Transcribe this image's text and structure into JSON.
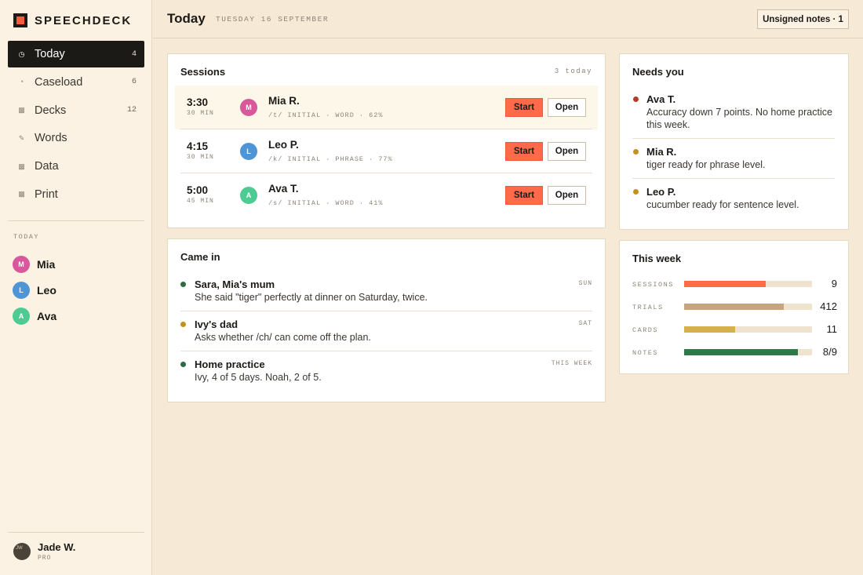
{
  "brand": {
    "name": "SPEECHDECK"
  },
  "nav": [
    {
      "label": "Today",
      "count": "4",
      "icon": "clock-icon",
      "active": true
    },
    {
      "label": "Caseload",
      "count": "6",
      "icon": "pie-icon",
      "active": false
    },
    {
      "label": "Decks",
      "count": "12",
      "icon": "square-icon",
      "active": false
    },
    {
      "label": "Words",
      "count": "",
      "icon": "pencil-icon",
      "active": false
    },
    {
      "label": "Data",
      "count": "",
      "icon": "square-icon",
      "active": false
    },
    {
      "label": "Print",
      "count": "",
      "icon": "square-icon",
      "active": false
    }
  ],
  "today_section": {
    "heading": "TODAY",
    "clients": [
      {
        "initial": "M",
        "name": "Mia",
        "color": "#d9579b"
      },
      {
        "initial": "L",
        "name": "Leo",
        "color": "#4f95d6"
      },
      {
        "initial": "A",
        "name": "Ava",
        "color": "#4ecb93"
      }
    ]
  },
  "user": {
    "name": "Jade W.",
    "role": "PRO",
    "initials": "JW"
  },
  "header": {
    "title": "Today",
    "date": "TUESDAY 16 SEPTEMBER",
    "unsigned_label": "Unsigned notes · 1"
  },
  "sessions": {
    "title": "Sessions",
    "meta": "3 today",
    "start_label": "Start",
    "open_label": "Open",
    "items": [
      {
        "time": "3:30",
        "duration": "30 MIN",
        "initial": "M",
        "color": "#d9579b",
        "name": "Mia R.",
        "detail": "/t/ INITIAL · WORD · 62%"
      },
      {
        "time": "4:15",
        "duration": "30 MIN",
        "initial": "L",
        "color": "#4f95d6",
        "name": "Leo P.",
        "detail": "/k/ INITIAL · PHRASE · 77%"
      },
      {
        "time": "5:00",
        "duration": "45 MIN",
        "initial": "A",
        "color": "#4ecb93",
        "name": "Ava T.",
        "detail": "/s/ INITIAL · WORD · 41%"
      }
    ]
  },
  "came_in": {
    "title": "Came in",
    "items": [
      {
        "from": "Sara, Mia's mum",
        "text": "She said \"tiger\" perfectly at dinner on Saturday, twice.",
        "when": "SUN",
        "color": "#2e6b45"
      },
      {
        "from": "Ivy's dad",
        "text": "Asks whether /ch/ can come off the plan.",
        "when": "SAT",
        "color": "#c4911e"
      },
      {
        "from": "Home practice",
        "text": "Ivy, 4 of 5 days. Noah, 2 of 5.",
        "when": "THIS WEEK",
        "color": "#2e6b45"
      }
    ]
  },
  "needs_you": {
    "title": "Needs you",
    "items": [
      {
        "name": "Ava T.",
        "text": "Accuracy down 7 points. No home practice this week.",
        "color": "#b53a2e"
      },
      {
        "name": "Mia R.",
        "text": "tiger ready for phrase level.",
        "color": "#c4911e"
      },
      {
        "name": "Leo P.",
        "text": "cucumber ready for sentence level.",
        "color": "#c4911e"
      }
    ]
  },
  "this_week": {
    "title": "This week",
    "stats": [
      {
        "label": "SESSIONS",
        "value": "9",
        "fraction": 0.64,
        "color": "#ff6b4a"
      },
      {
        "label": "TRIALS",
        "value": "412",
        "fraction": 0.78,
        "color": "#c7a57a"
      },
      {
        "label": "CARDS",
        "value": "11",
        "fraction": 0.4,
        "color": "#d6b04c"
      },
      {
        "label": "NOTES",
        "value": "8/9",
        "fraction": 0.89,
        "color": "#2e7a47"
      }
    ]
  }
}
